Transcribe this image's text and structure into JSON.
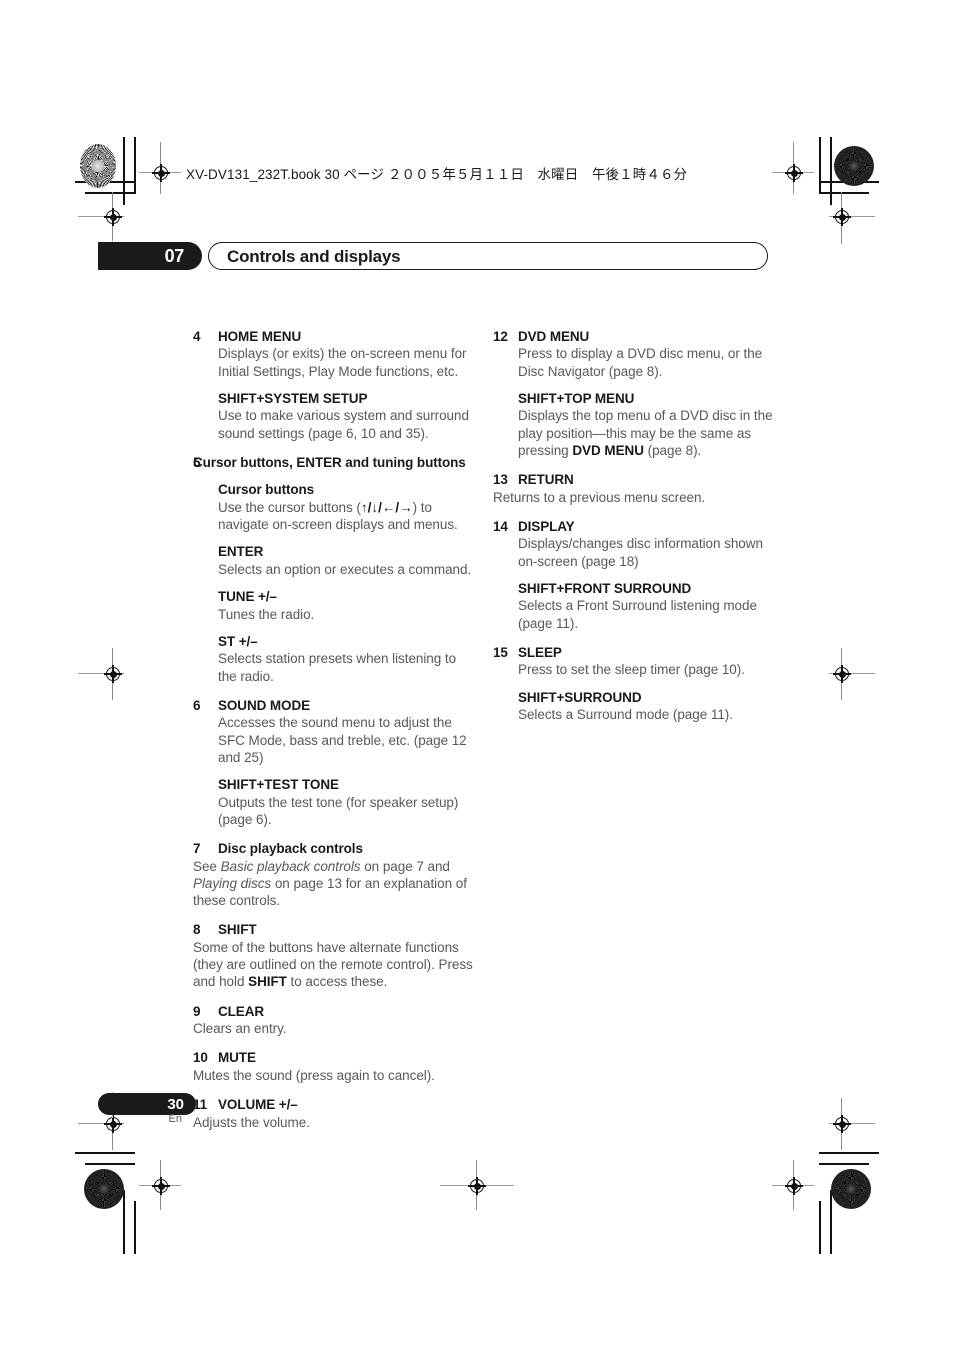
{
  "file_header": "XV-DV131_232T.book  30 ページ  ２００５年５月１１日　水曜日　午後１時４６分",
  "chapter": {
    "number": "07",
    "title": "Controls and displays"
  },
  "footer": {
    "page_number": "30",
    "language_code": "En"
  },
  "left_column": {
    "entries": [
      {
        "num": "4",
        "label": "HOME MENU",
        "desc": "Displays (or exits) the on-screen menu for Initial Settings, Play Mode functions, etc.",
        "sub_label": "SHIFT+SYSTEM SETUP",
        "sub_desc": "Use to make various system and surround sound settings (page 6, 10 and 35)."
      },
      {
        "num": "5",
        "label": "Cursor buttons, ENTER and tuning buttons",
        "sub_items": [
          {
            "label": "Cursor buttons",
            "desc_before": "Use the cursor buttons (",
            "arrows": "↑/↓/←/→",
            "desc_after": ") to navigate on-screen displays and menus."
          },
          {
            "label": "ENTER",
            "desc": "Selects an option or executes a command."
          },
          {
            "label": "TUNE +/–",
            "desc": "Tunes the radio."
          },
          {
            "label": "ST +/–",
            "desc": "Selects station presets when listening to the radio."
          }
        ]
      },
      {
        "num": "6",
        "label": "SOUND MODE",
        "desc": "Accesses the sound menu to adjust the SFC Mode, bass and treble, etc. (page 12 and 25)",
        "sub_label": "SHIFT+TEST TONE",
        "sub_desc": "Outputs the test tone (for speaker setup) (page 6)."
      },
      {
        "num": "7",
        "label": "Disc playback controls",
        "desc_parts": {
          "p1": "See ",
          "i1": "Basic playback controls",
          "p2": " on page 7 and ",
          "i2": "Playing discs",
          "p3": " on page 13 for an explanation of these controls."
        }
      },
      {
        "num": "8",
        "label": "SHIFT",
        "desc_parts": {
          "p1": "Some of the buttons have alternate functions (they are outlined on the remote control). Press and hold ",
          "b1": "SHIFT",
          "p2": " to access these."
        }
      },
      {
        "num": "9",
        "label": "CLEAR",
        "desc": "Clears an entry."
      },
      {
        "num": "10",
        "label": "MUTE",
        "desc": "Mutes the sound (press again to cancel)."
      },
      {
        "num": "11",
        "label": "VOLUME +/–",
        "desc": "Adjusts the volume."
      }
    ]
  },
  "right_column": {
    "entries": [
      {
        "num": "12",
        "label": "DVD MENU",
        "desc": "Press to display a DVD disc menu, or the Disc Navigator (page 8).",
        "sub_label": "SHIFT+TOP MENU",
        "sub_desc_parts": {
          "p1": "Displays the top menu of a DVD disc in the play position—this may be the same as pressing ",
          "b1": "DVD MENU",
          "p2": " (page 8)."
        }
      },
      {
        "num": "13",
        "label": "RETURN",
        "desc": "Returns to a previous menu screen."
      },
      {
        "num": "14",
        "label": "DISPLAY",
        "desc": "Displays/changes disc information shown on-screen (page 18)",
        "sub_label": "SHIFT+FRONT SURROUND",
        "sub_desc": "Selects a Front Surround listening mode (page 11)."
      },
      {
        "num": "15",
        "label": "SLEEP",
        "desc": "Press to set the sleep timer (page 10).",
        "sub_label": "SHIFT+SURROUND",
        "sub_desc": "Selects a Surround mode (page 11)."
      }
    ]
  },
  "icons": {
    "registration_target": "registration-target-icon",
    "density_starburst": "density-starburst-icon",
    "crop_mark": "crop-mark-icon"
  }
}
